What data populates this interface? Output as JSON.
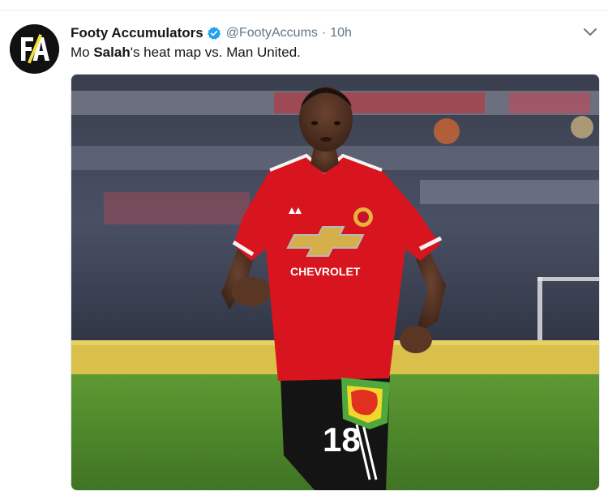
{
  "tweet": {
    "author_name": "Footy Accumulators",
    "handle": "@FootyAccums",
    "separator": "·",
    "time": "10h",
    "text_before": "Mo ",
    "text_bold": "Salah",
    "text_after": "'s heat map vs. Man United.",
    "avatar_text": "FA"
  },
  "media": {
    "sponsor": "CHEVROLET",
    "shirt_number": "18"
  },
  "icons": {
    "avatar": "footy-accumulators-logo",
    "verified": "verified-badge-icon",
    "menu": "chevron-down-icon"
  },
  "colors": {
    "accent": "#1da1f2",
    "text": "#14171a",
    "muted": "#657786",
    "shirt_red": "#d8141e",
    "pitch_green": "#4f8a2b"
  }
}
